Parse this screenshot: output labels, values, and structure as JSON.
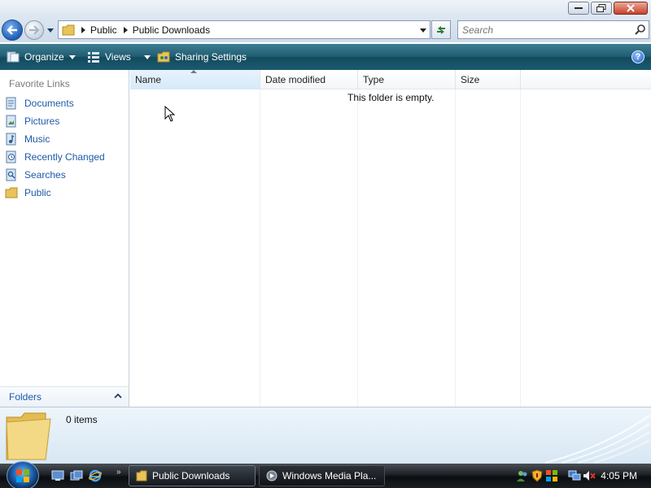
{
  "address": {
    "crumbs": [
      "Public",
      "Public Downloads"
    ]
  },
  "search": {
    "placeholder": "Search"
  },
  "commandbar": {
    "organize": "Organize",
    "views": "Views",
    "sharing": "Sharing Settings",
    "help_icon": "help-icon"
  },
  "navpane": {
    "title": "Favorite Links",
    "items": [
      {
        "label": "Documents",
        "icon": "documents-icon"
      },
      {
        "label": "Pictures",
        "icon": "pictures-icon"
      },
      {
        "label": "Music",
        "icon": "music-icon"
      },
      {
        "label": "Recently Changed",
        "icon": "recently-changed-icon"
      },
      {
        "label": "Searches",
        "icon": "searches-icon"
      },
      {
        "label": "Public",
        "icon": "folder-icon"
      }
    ],
    "folders_label": "Folders"
  },
  "content": {
    "columns": [
      "Name",
      "Date modified",
      "Type",
      "Size"
    ],
    "empty_message": "This folder is empty."
  },
  "details": {
    "count": "0 items"
  },
  "taskbar": {
    "buttons": [
      {
        "label": "Public Downloads"
      },
      {
        "label": "Windows Media Pla..."
      }
    ],
    "clock": "4:05 PM"
  },
  "colors": {
    "link": "#1e5aa8",
    "command_bar": "#1f5d73",
    "taskbar": "#1d2127"
  }
}
